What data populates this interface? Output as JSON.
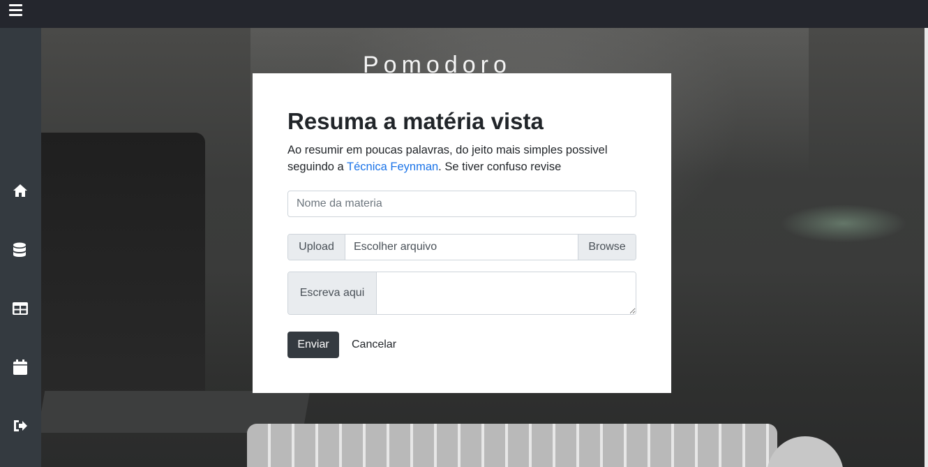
{
  "topbar": {
    "menu_icon": "hamburger-icon"
  },
  "sidebar": {
    "items": [
      {
        "icon": "home-icon"
      },
      {
        "icon": "database-icon"
      },
      {
        "icon": "table-icon"
      },
      {
        "icon": "calendar-icon"
      },
      {
        "icon": "sign-out-icon"
      }
    ]
  },
  "background": {
    "title": "Pomodoro"
  },
  "modal": {
    "title": "Resuma a matéria vista",
    "description_before": "Ao resumir em poucas palavras, do jeito mais simples possivel seguindo a ",
    "description_link": "Técnica Feynman",
    "description_after": ". Se tiver confuso revise",
    "subject_placeholder": "Nome da materia",
    "upload_label": "Upload",
    "file_label": "Escolher arquivo",
    "browse_label": "Browse",
    "write_label": "Escreva aqui",
    "send_label": "Enviar",
    "cancel_label": "Cancelar"
  },
  "colors": {
    "sidebar": "#343a40",
    "topbar": "#24262d",
    "link": "#1a73e8",
    "button": "#343a40"
  }
}
